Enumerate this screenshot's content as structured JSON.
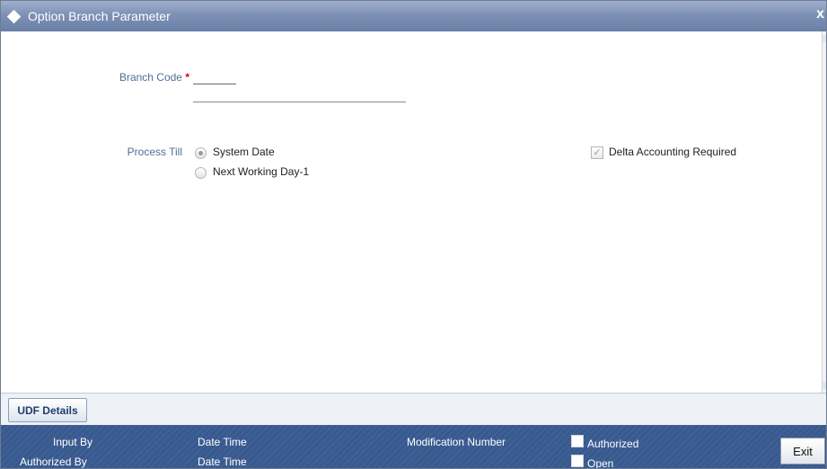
{
  "window": {
    "title": "Option Branch Parameter",
    "close_glyph": "x"
  },
  "form": {
    "branch_code_label": "Branch Code",
    "required_marker": "*",
    "branch_code_value": "",
    "branch_desc_value": "",
    "process_till_label": "Process Till",
    "process_till_options": [
      {
        "label": "System Date",
        "checked": true
      },
      {
        "label": "Next Working Day-1",
        "checked": false
      }
    ],
    "delta_accounting": {
      "label": "Delta Accounting Required",
      "checked": true,
      "check_glyph": "✓"
    }
  },
  "tabs": {
    "udf_label": "UDF Details"
  },
  "footer": {
    "input_by_label": "Input By",
    "authorized_by_label": "Authorized By",
    "date_time_label_1": "Date Time",
    "date_time_label_2": "Date Time",
    "modification_number_label": "Modification Number",
    "authorized_label": "Authorized",
    "open_label": "Open",
    "exit_label": "Exit"
  }
}
